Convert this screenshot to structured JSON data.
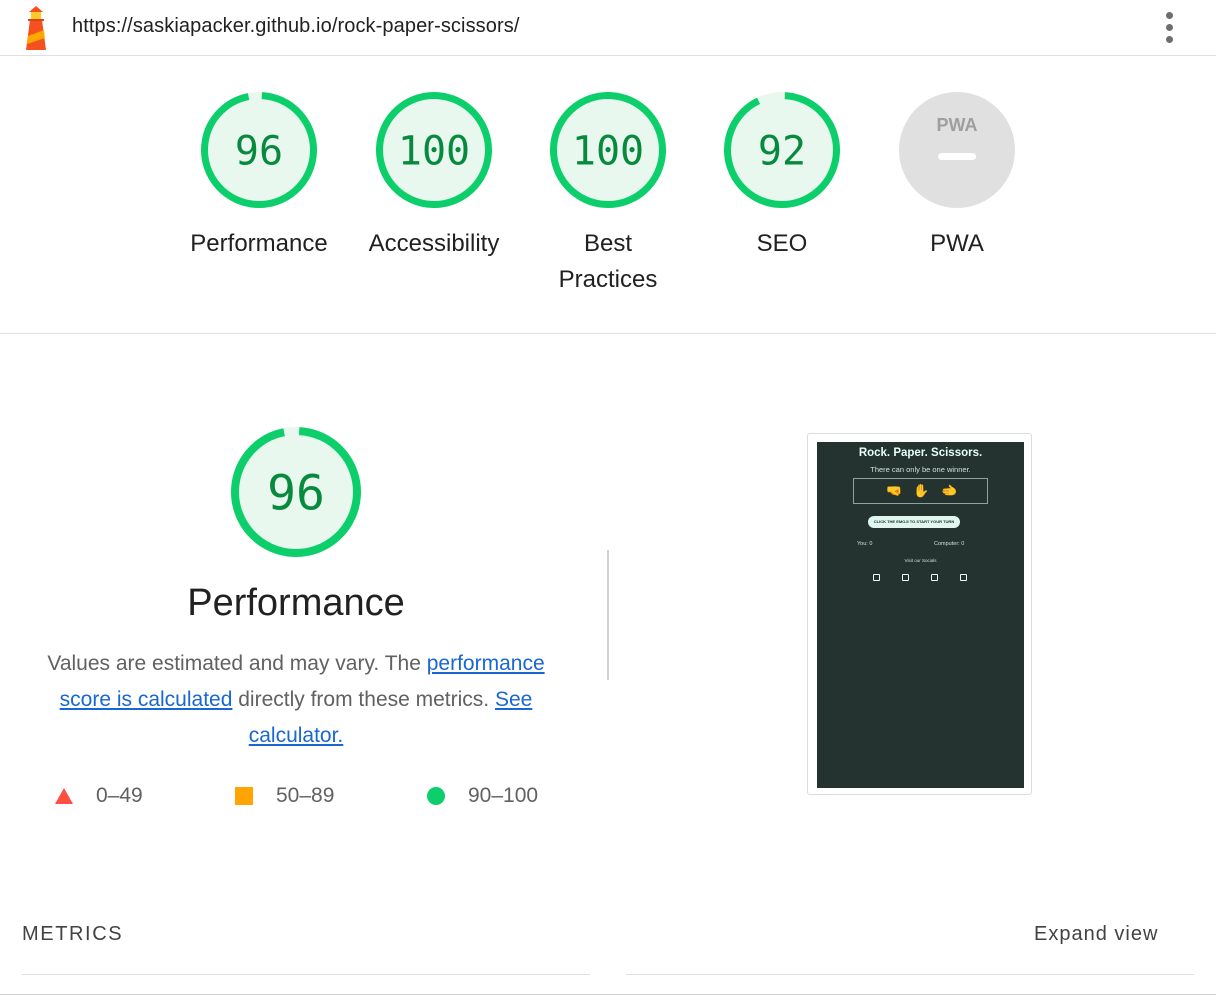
{
  "topbar": {
    "url": "https://saskiapacker.github.io/rock-paper-scissors/",
    "logo_icon": "lighthouse-icon",
    "menu_icon": "more-vertical-icon"
  },
  "colors": {
    "pass": "#0cce6b",
    "pass_fill": "#e8f8ee",
    "pass_text": "#088a3e",
    "average": "#ffa400",
    "fail": "#ff4e42",
    "link": "#1967d2",
    "na": "#e0e0e0"
  },
  "gauges": [
    {
      "score": "96",
      "label": "Performance",
      "fraction": 0.96
    },
    {
      "score": "100",
      "label": "Accessibility",
      "fraction": 1.0
    },
    {
      "score": "100",
      "label": "Best Practices",
      "fraction": 1.0
    },
    {
      "score": "92",
      "label": "SEO",
      "fraction": 0.92
    },
    {
      "score": "",
      "label": "PWA",
      "badge": "PWA",
      "icon": "pwa-icon"
    }
  ],
  "performance": {
    "score": "96",
    "fraction": 0.96,
    "title": "Performance",
    "desc_1": "Values are estimated and may vary. The ",
    "link_1": "performance score is calculated",
    "desc_2": " directly from these metrics. ",
    "link_2": "See calculator.",
    "legend": [
      {
        "range": "0–49",
        "icon": "triangle-icon"
      },
      {
        "range": "50–89",
        "icon": "square-icon"
      },
      {
        "range": "90–100",
        "icon": "circle-icon"
      }
    ]
  },
  "screenshot": {
    "title": "Rock. Paper. Scissors.",
    "subtitle": "There can only be one winner.",
    "emojis": [
      "🤜",
      "✋",
      "🫲"
    ],
    "button": "CLICK THE EMOJI TO START YOUR TURN",
    "you": "You: 0",
    "computer": "Computer: 0",
    "socials": "Visit our Socials",
    "social_icons": [
      "facebook-icon",
      "instagram-icon",
      "twitter-icon",
      "youtube-icon"
    ]
  },
  "metrics": {
    "label": "METRICS",
    "expand": "Expand view"
  }
}
